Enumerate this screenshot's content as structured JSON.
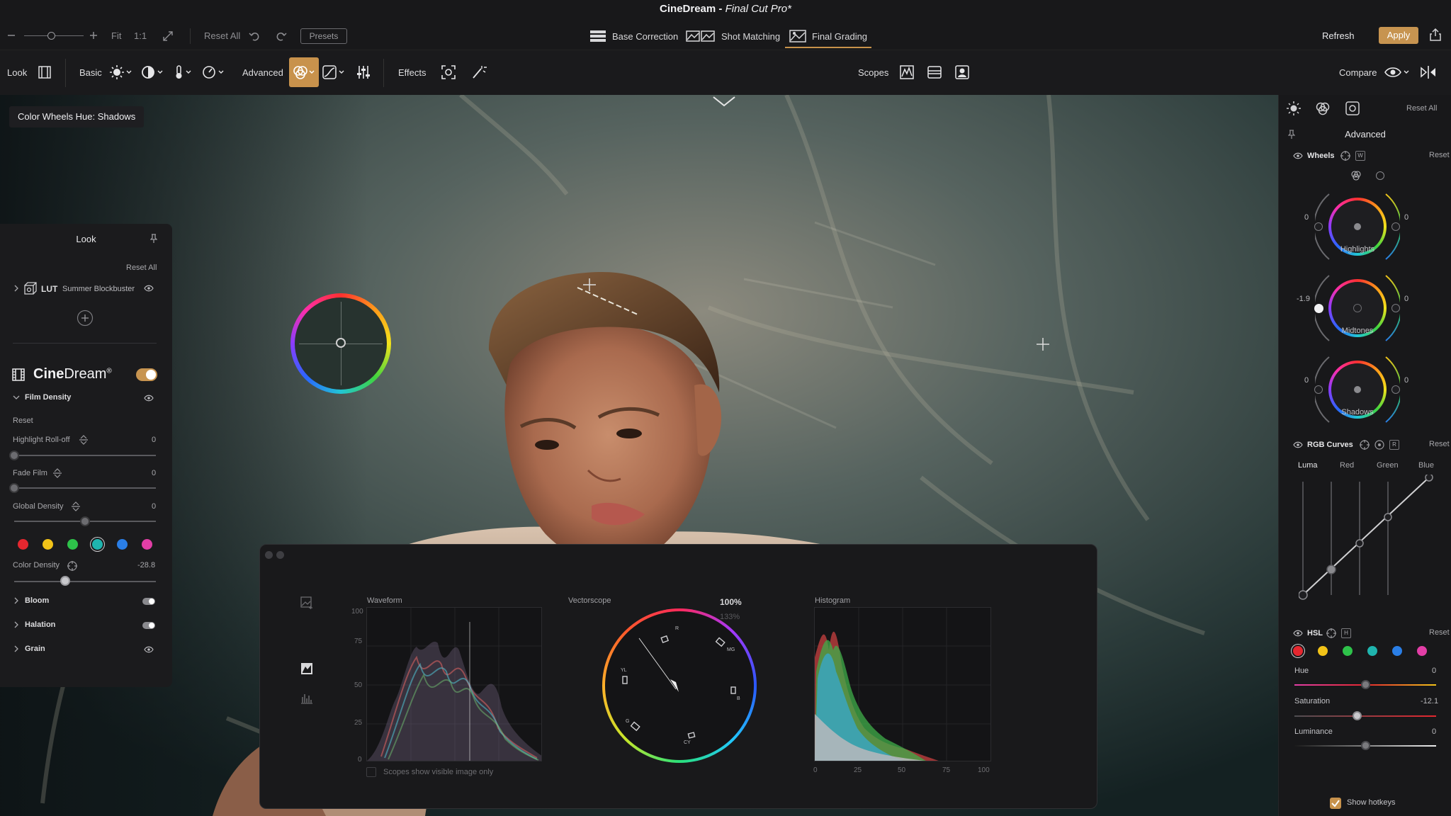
{
  "window": {
    "app_name": "CineDream",
    "separator": " - ",
    "document": "Final Cut Pro*"
  },
  "topbar": {
    "zoom_fit": "Fit",
    "zoom_one": "1:1",
    "reset_all": "Reset All",
    "presets": "Presets",
    "mode_tabs": [
      {
        "label": "Base Correction",
        "icon": "base-correction-icon",
        "active": false
      },
      {
        "label": "Shot Matching",
        "icon": "shot-matching-icon",
        "active": false
      },
      {
        "label": "Final Grading",
        "icon": "final-grading-icon",
        "active": true
      }
    ],
    "refresh": "Refresh",
    "apply": "Apply"
  },
  "toolbar": {
    "look": "Look",
    "basic": "Basic",
    "advanced": "Advanced",
    "effects": "Effects",
    "scopes": "Scopes",
    "compare": "Compare"
  },
  "viewer": {
    "hud_label": "Color Wheels Hue: Shadows"
  },
  "look_panel": {
    "title": "Look",
    "reset_all": "Reset All",
    "lut_tag": "LUT",
    "lut_name": "Summer Blockbuster",
    "brand_prefix": "Cine",
    "brand_suffix": "Dream",
    "brand_mark": "®",
    "film_density": "Film Density",
    "reset": "Reset",
    "sliders": [
      {
        "label": "Highlight Roll-off",
        "value": "0",
        "position": 0.0
      },
      {
        "label": "Fade Film",
        "value": "0",
        "position": 0.0
      },
      {
        "label": "Global Density",
        "value": "0",
        "position": 0.5
      }
    ],
    "color_dots": [
      "#e5272f",
      "#f2c318",
      "#2ec24a",
      "#1fb4ae",
      "#2a7ee6",
      "#e23ea6"
    ],
    "selected_dot_index": 3,
    "color_density": {
      "label": "Color Density",
      "value": "-28.8",
      "position": 0.36
    },
    "sections": [
      "Bloom",
      "Halation",
      "Grain"
    ]
  },
  "scopes": {
    "waveform": {
      "title": "Waveform",
      "y_ticks": [
        "100",
        "75",
        "50",
        "25",
        "0"
      ]
    },
    "vectorscope": {
      "title": "Vectorscope",
      "zoom_active": "100%",
      "zoom_alt": "133%",
      "targets": [
        "R",
        "MG",
        "B",
        "CY",
        "G",
        "YL"
      ]
    },
    "histogram": {
      "title": "Histogram",
      "x_ticks": [
        "0",
        "25",
        "50",
        "75",
        "100"
      ]
    },
    "visible_only": "Scopes show visible image only"
  },
  "right_panel": {
    "reset_all": "Reset All",
    "section_title": "Advanced",
    "wheels": {
      "title": "Wheels",
      "badge": "W",
      "reset": "Reset",
      "items": [
        {
          "name": "Highlights",
          "left": "0",
          "right": "0"
        },
        {
          "name": "Midtones",
          "left": "-1.9",
          "right": "0"
        },
        {
          "name": "Shadows",
          "left": "0",
          "right": "0"
        }
      ]
    },
    "curves": {
      "title": "RGB Curves",
      "badge": "R",
      "reset": "Reset",
      "channels": [
        "Luma",
        "Red",
        "Green",
        "Blue"
      ]
    },
    "hsl": {
      "title": "HSL",
      "badge": "H",
      "reset": "Reset",
      "color_dots": [
        "#e5272f",
        "#f2c318",
        "#2ec24a",
        "#1fb4ae",
        "#2a7ee6",
        "#e23ea6"
      ],
      "selected_dot_index": 0,
      "sliders": [
        {
          "label": "Hue",
          "value": "0",
          "position": 0.5
        },
        {
          "label": "Saturation",
          "value": "-12.1",
          "position": 0.44
        },
        {
          "label": "Luminance",
          "value": "0",
          "position": 0.5
        }
      ]
    },
    "show_hotkeys": "Show hotkeys"
  }
}
